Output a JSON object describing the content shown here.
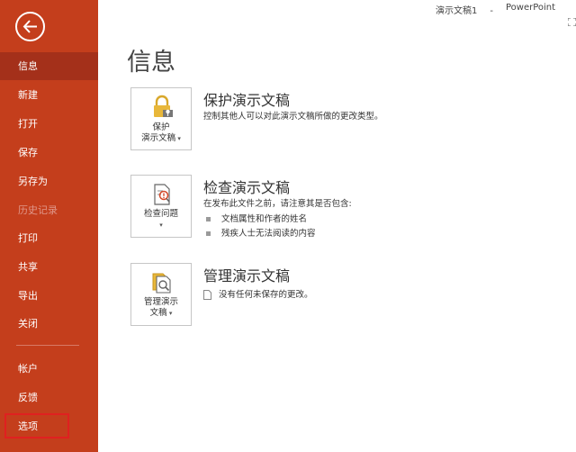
{
  "window": {
    "doc_title": "演示文稿1",
    "separator": "-",
    "app_name": "PowerPoint"
  },
  "sidebar": {
    "items": [
      {
        "label": "信息"
      },
      {
        "label": "新建"
      },
      {
        "label": "打开"
      },
      {
        "label": "保存"
      },
      {
        "label": "另存为"
      },
      {
        "label": "历史记录"
      },
      {
        "label": "打印"
      },
      {
        "label": "共享"
      },
      {
        "label": "导出"
      },
      {
        "label": "关闭"
      },
      {
        "label": "帐户"
      },
      {
        "label": "反馈"
      },
      {
        "label": "选项"
      }
    ]
  },
  "main": {
    "title": "信息",
    "sections": [
      {
        "button_line1": "保护",
        "button_line2": "演示文稿",
        "heading": "保护演示文稿",
        "description": "控制其他人可以对此演示文稿所做的更改类型。"
      },
      {
        "button_line1": "检查问题",
        "heading": "检查演示文稿",
        "description": "在发布此文件之前，请注意其是否包含:",
        "bullets": [
          "文档属性和作者的姓名",
          "残疾人士无法阅读的内容"
        ]
      },
      {
        "button_line1": "管理演示",
        "button_line2": "文稿",
        "heading": "管理演示文稿",
        "status": "没有任何未保存的更改。"
      }
    ]
  },
  "colors": {
    "sidebar_bg": "#c43e1c",
    "sidebar_active": "#a4301a",
    "highlight": "#e02020"
  }
}
